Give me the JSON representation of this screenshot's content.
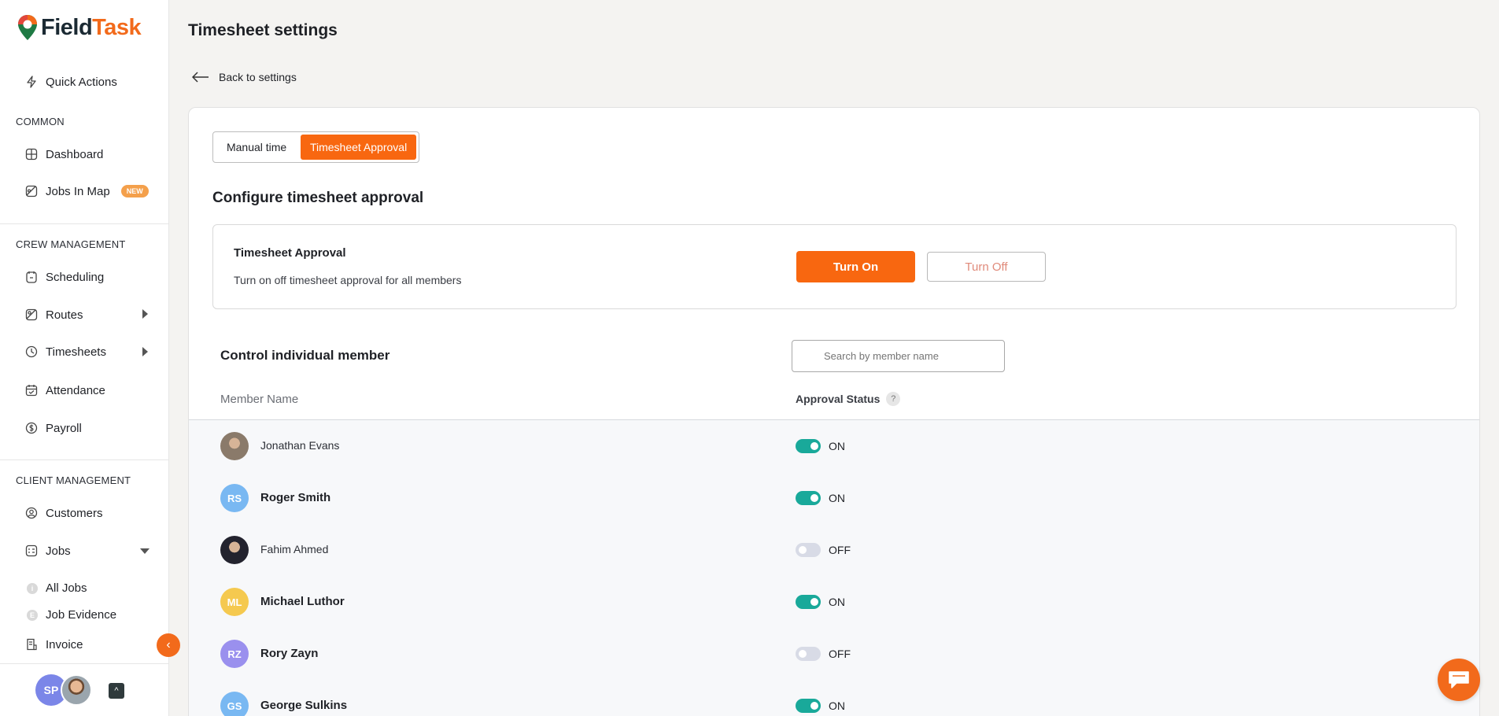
{
  "brand": {
    "name_part1": "Field",
    "name_part2": "Task",
    "orange": "#f26a1b",
    "teal": "#19a99a"
  },
  "sidebar": {
    "quick_actions": "Quick Actions",
    "sections": {
      "common": "COMMON",
      "crew": "CREW MANAGEMENT",
      "client": "CLIENT MANAGEMENT"
    },
    "items": {
      "dashboard": "Dashboard",
      "jobs_in_map": "Jobs In Map",
      "new_badge": "NEW",
      "scheduling": "Scheduling",
      "routes": "Routes",
      "timesheets": "Timesheets",
      "attendance": "Attendance",
      "payroll": "Payroll",
      "customers": "Customers",
      "jobs": "Jobs",
      "all_jobs": "All Jobs",
      "all_jobs_dot": "i",
      "job_evidence": "Job Evidence",
      "job_evidence_dot": "E",
      "invoice": "Invoice"
    },
    "user_initials": "SP",
    "collapse_glyph": "‹",
    "up_glyph": "^"
  },
  "page": {
    "title": "Timesheet settings",
    "back": "Back to settings"
  },
  "tabs": {
    "manual": "Manual time",
    "approval": "Timesheet Approval"
  },
  "config": {
    "title": "Configure timesheet approval",
    "box_title": "Timesheet Approval",
    "box_desc": "Turn on off timesheet approval for all members",
    "turn_on": "Turn On",
    "turn_off": "Turn Off"
  },
  "members": {
    "title": "Control individual member",
    "search_placeholder": "Search by member name",
    "col_name": "Member Name",
    "col_status": "Approval Status",
    "help": "?",
    "rows": [
      {
        "name": "Jonathan Evans",
        "initials": "",
        "status": "ON",
        "on": true,
        "avatar_color": "#8a7a6a",
        "photo": true,
        "bold": false
      },
      {
        "name": "Roger Smith",
        "initials": "RS",
        "status": "ON",
        "on": true,
        "avatar_color": "#79b8f2",
        "photo": false,
        "bold": true
      },
      {
        "name": "Fahim Ahmed",
        "initials": "",
        "status": "OFF",
        "on": false,
        "avatar_color": "#23232e",
        "photo": true,
        "bold": false
      },
      {
        "name": "Michael Luthor",
        "initials": "ML",
        "status": "ON",
        "on": true,
        "avatar_color": "#f5c94f",
        "photo": false,
        "bold": true
      },
      {
        "name": "Rory Zayn",
        "initials": "RZ",
        "status": "OFF",
        "on": false,
        "avatar_color": "#9a90ee",
        "photo": false,
        "bold": true
      },
      {
        "name": "George Sulkins",
        "initials": "GS",
        "status": "ON",
        "on": true,
        "avatar_color": "#79b8f2",
        "photo": false,
        "bold": true
      }
    ]
  }
}
